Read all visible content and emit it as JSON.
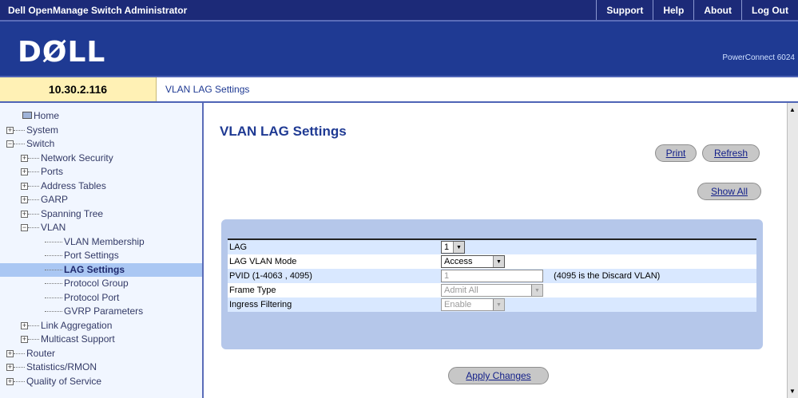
{
  "app": {
    "title": "Dell OpenManage Switch Administrator",
    "links": [
      "Support",
      "Help",
      "About",
      "Log Out"
    ],
    "logo": "DØLL",
    "product": "PowerConnect 6024",
    "ip": "10.30.2.116",
    "breadcrumb": "VLAN LAG Settings"
  },
  "tree": [
    {
      "label": "Home",
      "icon": "home-icon",
      "level": 0,
      "exp": ""
    },
    {
      "label": "System",
      "level": 1,
      "exp": "+"
    },
    {
      "label": "Switch",
      "level": 1,
      "exp": "-"
    },
    {
      "label": "Network Security",
      "level": 2,
      "exp": "+"
    },
    {
      "label": "Ports",
      "level": 2,
      "exp": "+"
    },
    {
      "label": "Address Tables",
      "level": 2,
      "exp": "+"
    },
    {
      "label": "GARP",
      "level": 2,
      "exp": "+"
    },
    {
      "label": "Spanning Tree",
      "level": 2,
      "exp": "+"
    },
    {
      "label": "VLAN",
      "level": 2,
      "exp": "-"
    },
    {
      "label": "VLAN Membership",
      "level": 3,
      "exp": ""
    },
    {
      "label": "Port Settings",
      "level": 3,
      "exp": ""
    },
    {
      "label": "LAG Settings",
      "level": 3,
      "exp": "",
      "selected": true
    },
    {
      "label": "Protocol Group",
      "level": 3,
      "exp": ""
    },
    {
      "label": "Protocol Port",
      "level": 3,
      "exp": ""
    },
    {
      "label": "GVRP Parameters",
      "level": 3,
      "exp": ""
    },
    {
      "label": "Link Aggregation",
      "level": 2,
      "exp": "+"
    },
    {
      "label": "Multicast Support",
      "level": 2,
      "exp": "+"
    },
    {
      "label": "Router",
      "level": 1,
      "exp": "+"
    },
    {
      "label": "Statistics/RMON",
      "level": 1,
      "exp": "+"
    },
    {
      "label": "Quality of Service",
      "level": 1,
      "exp": "+"
    }
  ],
  "page": {
    "title": "VLAN LAG Settings",
    "print_label": "Print",
    "refresh_label": "Refresh",
    "show_all_label": "Show All",
    "apply_label": "Apply Changes"
  },
  "form": {
    "lag": {
      "label": "LAG",
      "value": "1"
    },
    "mode": {
      "label": "LAG VLAN Mode",
      "value": "Access"
    },
    "pvid": {
      "label": "PVID (1-4063 , 4095)",
      "value": "1",
      "note": "(4095 is the Discard VLAN)"
    },
    "frame": {
      "label": "Frame Type",
      "value": "Admit All"
    },
    "ingress": {
      "label": "Ingress Filtering",
      "value": "Enable"
    }
  }
}
